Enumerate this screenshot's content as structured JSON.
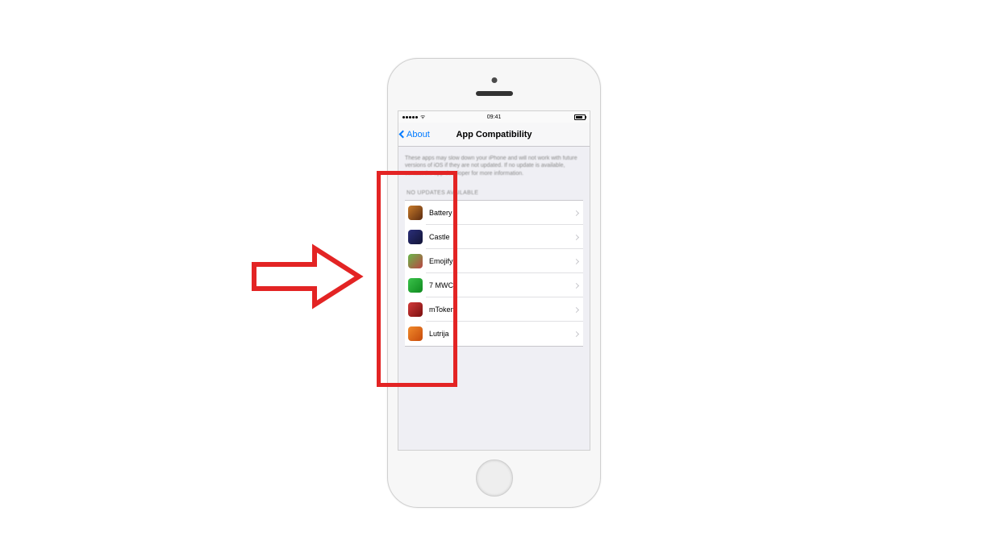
{
  "status_bar": {
    "carrier_signal_dots": "5",
    "wifi_glyph": "ᯤ",
    "time": "09:41",
    "battery_pct": "70"
  },
  "nav": {
    "back_label": "About",
    "title": "App Compatibility"
  },
  "description": "These apps may slow down your iPhone and will not work with future versions of iOS if they are not updated. If no update is available, contact the app developer for more information.",
  "section_header": "NO UPDATES AVAILABLE",
  "apps": {
    "0": {
      "name": "Battery",
      "icon_class": "c-battery"
    },
    "1": {
      "name": "Castle",
      "icon_class": "c-castle"
    },
    "2": {
      "name": "Emojify",
      "icon_class": "c-emojify"
    },
    "3": {
      "name": "7 MWC",
      "icon_class": "c-7mwc"
    },
    "4": {
      "name": "mToken",
      "icon_class": "c-mtoken"
    },
    "5": {
      "name": "Lutrija",
      "icon_class": "c-lutrija"
    }
  },
  "annotation": {
    "arrow_color": "#e32424"
  }
}
